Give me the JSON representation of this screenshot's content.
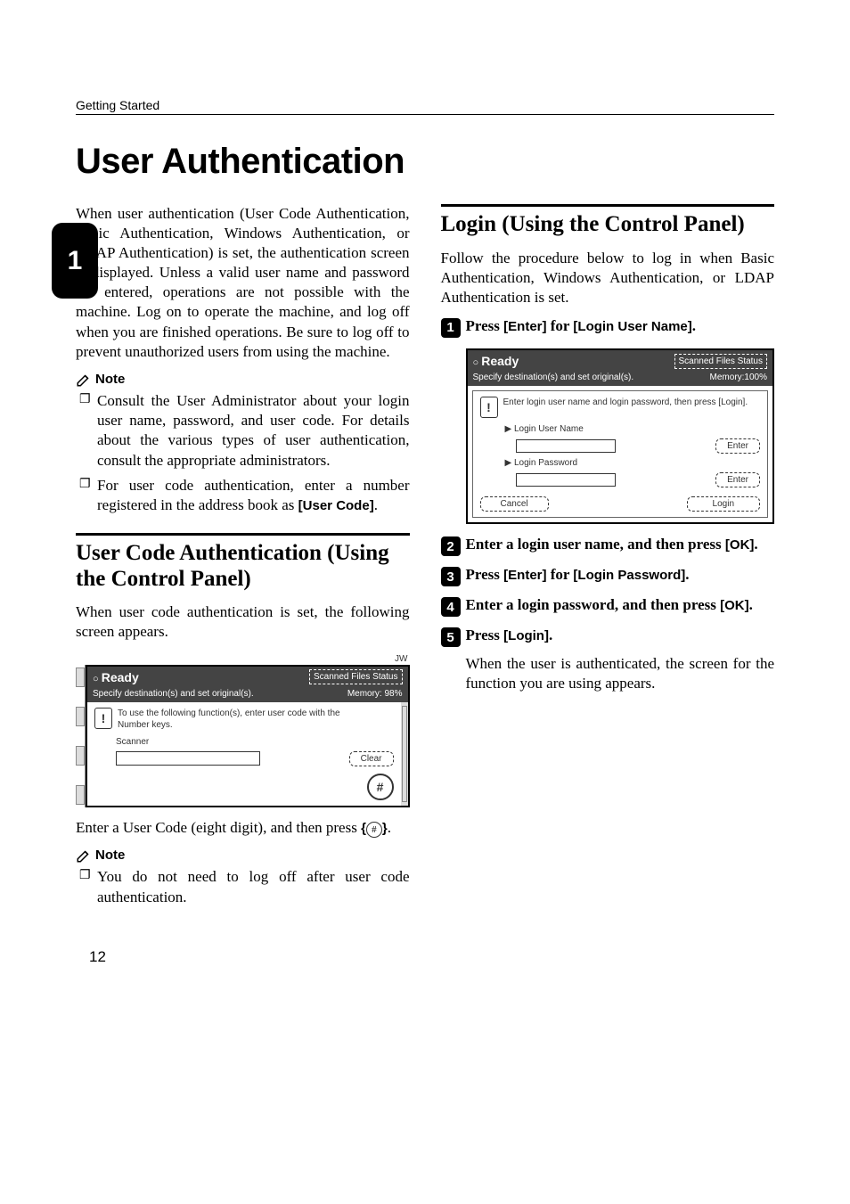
{
  "running_head": "Getting Started",
  "chapter_tab": "1",
  "chapter_title": "User Authentication",
  "left": {
    "intro": "When user authentication (User Code Authentication, Basic Authentication, Windows Authentication, or LDAP Authentication) is set, the authentication screen is displayed. Unless a valid user name and password are entered, operations are not possible with the machine. Log on to operate the machine, and log off when you are finished operations. Be sure to log off to prevent unauthorized users from using the machine.",
    "note_label": "Note",
    "notes": [
      "Consult the User Administrator about your login user name, password, and user code. For details about the various types of user authentication, consult the appropriate administrators.",
      "For user code authentication, enter a number registered in the address book as "
    ],
    "user_code_bold": "[User Code]",
    "section1_title": "User Code Authentication (Using the Control Panel)",
    "section1_body": "When user code authentication is set, the following screen appears.",
    "section1_after_img_a": "Enter a User Code (eight digit), and then press ",
    "section1_after_img_b": ".",
    "note2": "You do not need to log off after user code authentication.",
    "shot1": {
      "jw": "JW",
      "ready": "Ready",
      "sfs": "Scanned Files Status",
      "sub_left": "Specify destination(s) and set original(s).",
      "sub_right": "Memory:  98%",
      "msg1": "To use the following function(s), enter user code with the",
      "msg2": "Number keys.",
      "scanner": "Scanner",
      "clear": "Clear"
    }
  },
  "right": {
    "section_title": "Login (Using the Control Panel)",
    "intro": "Follow the procedure below to log in when Basic Authentication, Windows Authentication, or LDAP Authentication is set.",
    "steps": {
      "s1_a": "Press ",
      "s1_b": "[Enter]",
      "s1_c": " for ",
      "s1_d": "[Login User Name]",
      "s1_e": ".",
      "s2_a": "Enter a login user name, and then press ",
      "s2_b": "[OK]",
      "s2_c": ".",
      "s3_a": "Press ",
      "s3_b": "[Enter]",
      "s3_c": " for ",
      "s3_d": "[Login Password]",
      "s3_e": ".",
      "s4_a": "Enter a login password, and then press ",
      "s4_b": "[OK]",
      "s4_c": ".",
      "s5_a": "Press ",
      "s5_b": "[Login]",
      "s5_c": ".",
      "s5_desc": "When the user is authenticated, the screen for the function you are using appears."
    },
    "shot2": {
      "ready": "Ready",
      "sfs": "Scanned Files Status",
      "sub_left": "Specify destination(s) and set original(s).",
      "sub_right": "Memory:100%",
      "msg": "Enter login user name and login password, then press [Login].",
      "lun": "Login User Name",
      "lpw": "Login Password",
      "enter": "Enter",
      "cancel": "Cancel",
      "login": "Login"
    }
  },
  "page_number": "12",
  "hash_key": "[q]"
}
